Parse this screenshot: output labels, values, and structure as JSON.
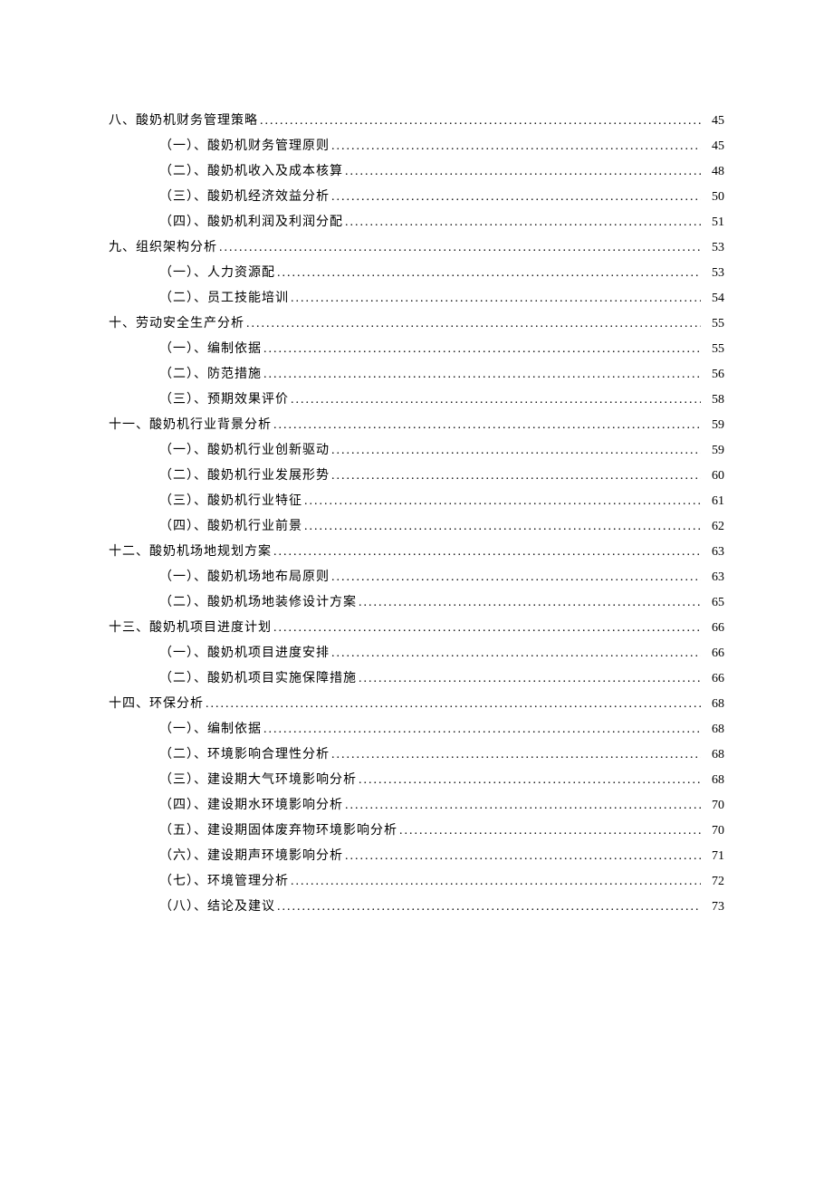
{
  "toc": [
    {
      "level": 1,
      "title": "八、酸奶机财务管理策略",
      "page": "45"
    },
    {
      "level": 2,
      "title": "（一）、酸奶机财务管理原则",
      "page": "45"
    },
    {
      "level": 2,
      "title": "（二）、酸奶机收入及成本核算",
      "page": "48"
    },
    {
      "level": 2,
      "title": "（三）、酸奶机经济效益分析",
      "page": "50"
    },
    {
      "level": 2,
      "title": "（四）、酸奶机利润及利润分配",
      "page": "51"
    },
    {
      "level": 1,
      "title": "九、组织架构分析",
      "page": "53"
    },
    {
      "level": 2,
      "title": "（一）、人力资源配",
      "page": "53"
    },
    {
      "level": 2,
      "title": "（二）、员工技能培训",
      "page": "54"
    },
    {
      "level": 1,
      "title": "十、劳动安全生产分析",
      "page": "55"
    },
    {
      "level": 2,
      "title": "（一）、编制依据",
      "page": "55"
    },
    {
      "level": 2,
      "title": "（二）、防范措施",
      "page": "56"
    },
    {
      "level": 2,
      "title": "（三）、预期效果评价",
      "page": "58"
    },
    {
      "level": 1,
      "title": "十一、酸奶机行业背景分析",
      "page": "59"
    },
    {
      "level": 2,
      "title": "（一）、酸奶机行业创新驱动",
      "page": "59"
    },
    {
      "level": 2,
      "title": "（二）、酸奶机行业发展形势",
      "page": "60"
    },
    {
      "level": 2,
      "title": "（三）、酸奶机行业特征",
      "page": "61"
    },
    {
      "level": 2,
      "title": "（四）、酸奶机行业前景",
      "page": "62"
    },
    {
      "level": 1,
      "title": "十二、酸奶机场地规划方案",
      "page": "63"
    },
    {
      "level": 2,
      "title": "（一）、酸奶机场地布局原则",
      "page": "63"
    },
    {
      "level": 2,
      "title": "（二）、酸奶机场地装修设计方案",
      "page": "65"
    },
    {
      "level": 1,
      "title": "十三、酸奶机项目进度计划",
      "page": "66"
    },
    {
      "level": 2,
      "title": "（一）、酸奶机项目进度安排",
      "page": "66"
    },
    {
      "level": 2,
      "title": "（二）、酸奶机项目实施保障措施",
      "page": "66"
    },
    {
      "level": 1,
      "title": "十四、环保分析",
      "page": "68"
    },
    {
      "level": 2,
      "title": "（一）、编制依据",
      "page": "68"
    },
    {
      "level": 2,
      "title": "（二）、环境影响合理性分析",
      "page": "68"
    },
    {
      "level": 2,
      "title": "（三）、建设期大气环境影响分析",
      "page": "68"
    },
    {
      "level": 2,
      "title": "（四）、建设期水环境影响分析",
      "page": "70"
    },
    {
      "level": 2,
      "title": "（五）、建设期固体废弃物环境影响分析",
      "page": "70"
    },
    {
      "level": 2,
      "title": "（六）、建设期声环境影响分析",
      "page": "71"
    },
    {
      "level": 2,
      "title": "（七）、环境管理分析",
      "page": "72"
    },
    {
      "level": 2,
      "title": "（八）、结论及建议",
      "page": "73"
    }
  ]
}
